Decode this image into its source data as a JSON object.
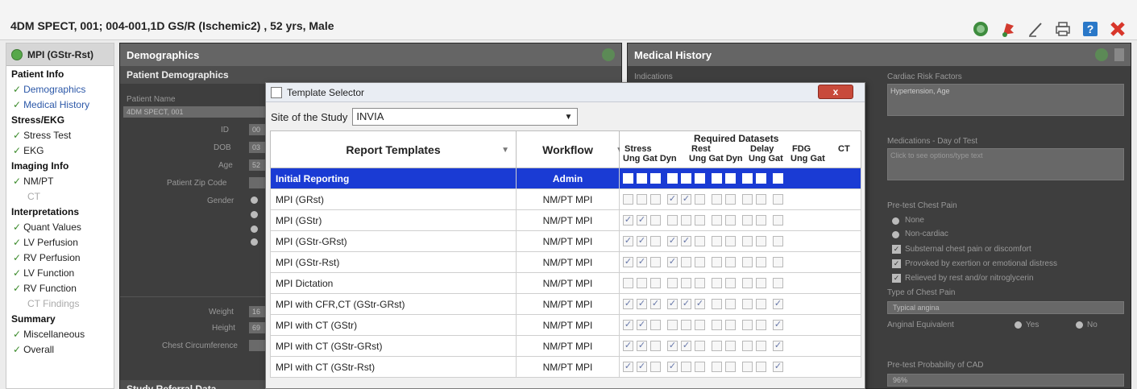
{
  "window": {
    "title": "4DM SPECT, 001; 004-001,1D GS/R (Ischemic2) , 52 yrs, Male"
  },
  "toolbar": {
    "icons": [
      "refresh-icon",
      "flag-icon",
      "pen-icon",
      "print-icon",
      "help-icon",
      "close-icon"
    ]
  },
  "sidebar": {
    "header": "MPI (GStr-Rst)",
    "sections": [
      {
        "title": "Patient Info",
        "items": [
          {
            "label": "Demographics",
            "checked": true,
            "selected": true
          },
          {
            "label": "Medical History",
            "checked": true,
            "selected": true
          }
        ]
      },
      {
        "title": "Stress/EKG",
        "items": [
          {
            "label": "Stress Test",
            "checked": true
          },
          {
            "label": "EKG",
            "checked": true
          }
        ]
      },
      {
        "title": "Imaging Info",
        "items": [
          {
            "label": "NM/PT",
            "checked": true
          },
          {
            "label": "CT",
            "checked": false
          }
        ]
      },
      {
        "title": "Interpretations",
        "items": [
          {
            "label": "Quant Values",
            "checked": true
          },
          {
            "label": "LV Perfusion",
            "checked": true
          },
          {
            "label": "RV Perfusion",
            "checked": true
          },
          {
            "label": "LV Function",
            "checked": true
          },
          {
            "label": "RV Function",
            "checked": true
          },
          {
            "label": "CT Findings",
            "checked": false
          }
        ]
      },
      {
        "title": "Summary",
        "items": [
          {
            "label": "Miscellaneous",
            "checked": true
          },
          {
            "label": "Overall",
            "checked": true
          }
        ]
      }
    ]
  },
  "demographics": {
    "title": "Demographics",
    "subhead": "Patient Demographics",
    "patient_name_label": "Patient Name",
    "patient_name": "4DM SPECT, 001",
    "id_label": "ID",
    "id_val": "00",
    "dob_label": "DOB",
    "dob_val": "03",
    "age_label": "Age",
    "age_val": "52",
    "zip_label": "Patient Zip Code",
    "gender_label": "Gender",
    "weight_label": "Weight",
    "weight_val": "16",
    "height_label": "Height",
    "height_val": "69",
    "chest_label": "Chest Circumference",
    "referral_head": "Study Referral Data"
  },
  "medical": {
    "title": "Medical History",
    "indications_label": "Indications",
    "risk_label": "Cardiac Risk Factors",
    "risk_val": "Hypertension, Age",
    "meds_label": "Medications - Day of Test",
    "meds_placeholder": "Click to see options/type text",
    "chest_pain_label": "Pre-test Chest Pain",
    "pain_options": [
      "None",
      "Non-cardiac"
    ],
    "pain_checks": [
      "Substernal chest pain or discomfort",
      "Provoked by exertion or emotional distress",
      "Relieved by rest and/or nitroglycerin"
    ],
    "type_label": "Type of Chest Pain",
    "type_val": "Typical angina",
    "anginal_label": "Anginal Equivalent",
    "yes": "Yes",
    "no": "No",
    "prob_label": "Pre-test Probability of CAD",
    "prob_val": "96%"
  },
  "dialog": {
    "title": "Template Selector",
    "close": "x",
    "site_label": "Site of the Study",
    "site_value": "INVIA",
    "col_templates": "Report Templates",
    "col_workflow": "Workflow",
    "col_required": "Required Datasets",
    "grp_stress": "Stress",
    "grp_rest": "Rest",
    "grp_delay": "Delay",
    "grp_fdg": "FDG",
    "grp_ct": "CT",
    "sub_stress": "Ung Gat Dyn",
    "sub_rest": "Ung Gat Dyn",
    "sub_delay": "Ung Gat",
    "sub_fdg": "Ung Gat",
    "rows": [
      {
        "name": "Initial Reporting",
        "workflow": "Admin",
        "checks": [
          0,
          0,
          0,
          0,
          0,
          0,
          0,
          0,
          0,
          0,
          0
        ],
        "selected": true
      },
      {
        "name": "MPI (GRst)",
        "workflow": "NM/PT MPI",
        "checks": [
          0,
          0,
          0,
          1,
          1,
          0,
          0,
          0,
          0,
          0,
          0
        ]
      },
      {
        "name": "MPI (GStr)",
        "workflow": "NM/PT MPI",
        "checks": [
          1,
          1,
          0,
          0,
          0,
          0,
          0,
          0,
          0,
          0,
          0
        ]
      },
      {
        "name": "MPI (GStr-GRst)",
        "workflow": "NM/PT MPI",
        "checks": [
          1,
          1,
          0,
          1,
          1,
          0,
          0,
          0,
          0,
          0,
          0
        ]
      },
      {
        "name": "MPI (GStr-Rst)",
        "workflow": "NM/PT MPI",
        "checks": [
          1,
          1,
          0,
          1,
          0,
          0,
          0,
          0,
          0,
          0,
          0
        ]
      },
      {
        "name": "MPI Dictation",
        "workflow": "NM/PT MPI",
        "checks": [
          0,
          0,
          0,
          0,
          0,
          0,
          0,
          0,
          0,
          0,
          0
        ]
      },
      {
        "name": "MPI with CFR,CT (GStr-GRst)",
        "workflow": "NM/PT MPI",
        "checks": [
          1,
          1,
          1,
          1,
          1,
          1,
          0,
          0,
          0,
          0,
          1
        ]
      },
      {
        "name": "MPI with CT (GStr)",
        "workflow": "NM/PT MPI",
        "checks": [
          1,
          1,
          0,
          0,
          0,
          0,
          0,
          0,
          0,
          0,
          1
        ]
      },
      {
        "name": "MPI with CT (GStr-GRst)",
        "workflow": "NM/PT MPI",
        "checks": [
          1,
          1,
          0,
          1,
          1,
          0,
          0,
          0,
          0,
          0,
          1
        ]
      },
      {
        "name": "MPI with CT (GStr-Rst)",
        "workflow": "NM/PT MPI",
        "checks": [
          1,
          1,
          0,
          1,
          0,
          0,
          0,
          0,
          0,
          0,
          1
        ]
      }
    ]
  }
}
